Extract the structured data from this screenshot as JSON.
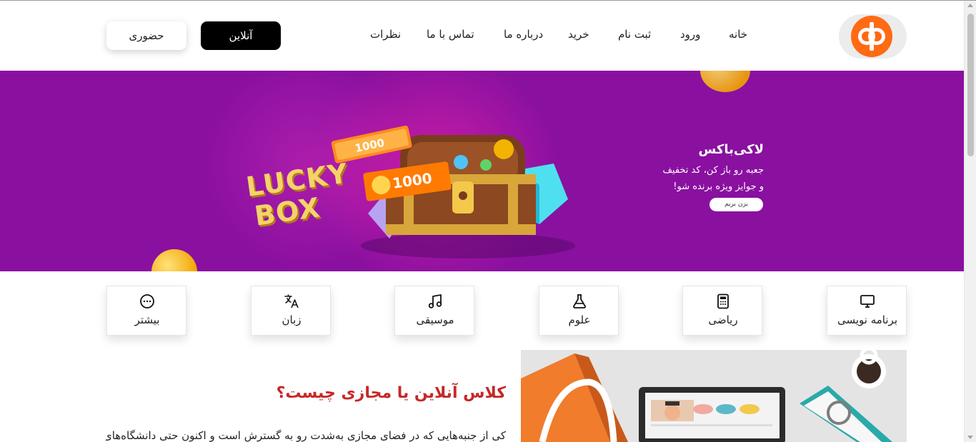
{
  "header": {
    "nav": [
      {
        "id": "home",
        "label": "خانه"
      },
      {
        "id": "login",
        "label": "ورود"
      },
      {
        "id": "register",
        "label": "ثبت نام"
      },
      {
        "id": "shop",
        "label": "خرید"
      },
      {
        "id": "about",
        "label": "درباره ما"
      },
      {
        "id": "contact",
        "label": "تماس با ما"
      },
      {
        "id": "reviews",
        "label": "نظرات"
      }
    ],
    "online_label": "آنلاین",
    "inperson_label": "حضوری"
  },
  "banner": {
    "art_text_line1": "LUCKY",
    "art_text_line2": "BOX",
    "ticket_value": "1000",
    "title": "لاکی‌باکس",
    "text_line1": "جعبه رو باز کن، کد تخفیف",
    "text_line2": "و جوایز ویژه برنده شو!",
    "button_label": "بزن بریم"
  },
  "categories": [
    {
      "label": "برنامه نویسی",
      "icon": "monitor-icon"
    },
    {
      "label": "ریاضی",
      "icon": "calculator-icon"
    },
    {
      "label": "علوم",
      "icon": "flask-icon"
    },
    {
      "label": "موسیقی",
      "icon": "music-note-icon"
    },
    {
      "label": "زبان",
      "icon": "translate-icon"
    },
    {
      "label": "بیشتر",
      "icon": "more-dots-icon"
    }
  ],
  "content": {
    "heading": "کلاس آنلاین یا مجازی چیست؟",
    "paragraph": "کی از جنبه‌هایی که در فضای مجازی به‌شدت رو به گسترش است و اکنون حتی دانشگاه‌های"
  },
  "colors": {
    "banner_bg": "#8a10a0",
    "brand_orange": "#ff6a13",
    "heading_red": "#c62828",
    "button_black": "#000000"
  }
}
